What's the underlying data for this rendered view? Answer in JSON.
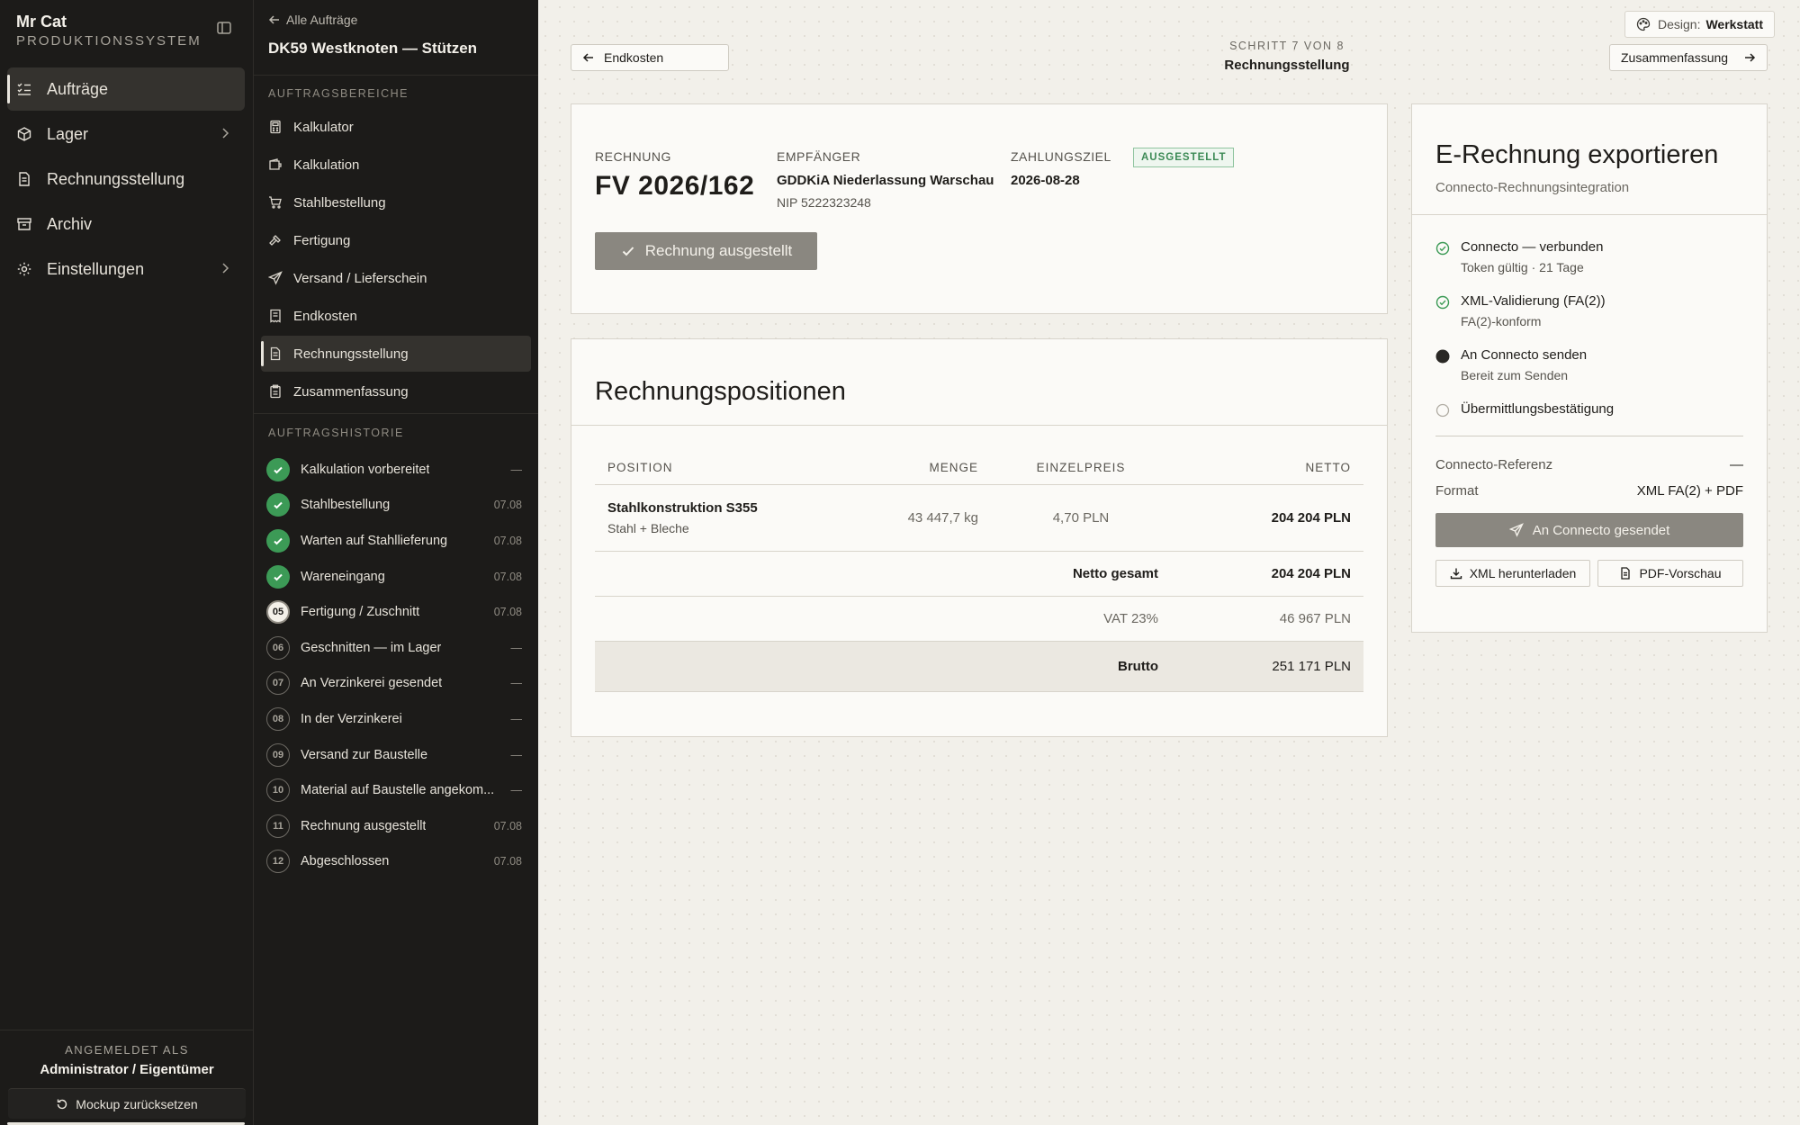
{
  "sidebar": {
    "brand_name": "Mr Cat",
    "brand_sub": "PRODUKTIONSSYSTEM",
    "nav": [
      {
        "label": "Aufträge",
        "icon": "list-check-icon",
        "active": true,
        "chevron": false
      },
      {
        "label": "Lager",
        "icon": "package-icon",
        "active": false,
        "chevron": true
      },
      {
        "label": "Rechnungsstellung",
        "icon": "document-icon",
        "active": false,
        "chevron": false
      },
      {
        "label": "Archiv",
        "icon": "archive-icon",
        "active": false,
        "chevron": false
      },
      {
        "label": "Einstellungen",
        "icon": "gear-icon",
        "active": false,
        "chevron": true
      }
    ],
    "footer_label": "ANGEMELDET ALS",
    "footer_user": "Administrator / Eigentümer",
    "reset_label": "Mockup zurücksetzen"
  },
  "panel": {
    "back_label": "Alle Aufträge",
    "job_title": "DK59 Westknoten — Stützen",
    "areas_heading": "AUFTRAGSBEREICHE",
    "areas": [
      {
        "label": "Kalkulator",
        "icon": "calculator-icon"
      },
      {
        "label": "Kalkulation",
        "icon": "wallet-icon"
      },
      {
        "label": "Stahlbestellung",
        "icon": "cart-icon"
      },
      {
        "label": "Fertigung",
        "icon": "hammer-icon"
      },
      {
        "label": "Versand / Lieferschein",
        "icon": "send-icon"
      },
      {
        "label": "Endkosten",
        "icon": "receipt-icon"
      },
      {
        "label": "Rechnungsstellung",
        "icon": "document-icon",
        "active": true
      },
      {
        "label": "Zusammenfassung",
        "icon": "clipboard-icon"
      }
    ],
    "history_heading": "AUFTRAGSHISTORIE",
    "history": [
      {
        "badge": "",
        "state": "done",
        "label": "Kalkulation vorbereitet",
        "date": "—"
      },
      {
        "badge": "",
        "state": "done",
        "label": "Stahlbestellung",
        "date": "07.08"
      },
      {
        "badge": "",
        "state": "done",
        "label": "Warten auf Stahllieferung",
        "date": "07.08"
      },
      {
        "badge": "",
        "state": "done",
        "label": "Wareneingang",
        "date": "07.08"
      },
      {
        "badge": "05",
        "state": "current",
        "label": "Fertigung / Zuschnitt",
        "date": "07.08"
      },
      {
        "badge": "06",
        "state": "pending",
        "label": "Geschnitten — im Lager",
        "date": "—"
      },
      {
        "badge": "07",
        "state": "pending",
        "label": "An Verzinkerei gesendet",
        "date": "—"
      },
      {
        "badge": "08",
        "state": "pending",
        "label": "In der Verzinkerei",
        "date": "—"
      },
      {
        "badge": "09",
        "state": "pending",
        "label": "Versand zur Baustelle",
        "date": "—"
      },
      {
        "badge": "10",
        "state": "pending",
        "label": "Material auf Baustelle angekom...",
        "date": "—"
      },
      {
        "badge": "11",
        "state": "pending",
        "label": "Rechnung ausgestellt",
        "date": "07.08"
      },
      {
        "badge": "12",
        "state": "pending",
        "label": "Abgeschlossen",
        "date": "07.08"
      }
    ]
  },
  "topbar": {
    "design_label": "Design:",
    "design_value": "Werkstatt",
    "prev_label": "Endkosten",
    "next_label": "Zusammenfassung",
    "step_small": "SCHRITT 7 VON 8",
    "step_title": "Rechnungsstellung"
  },
  "invoice": {
    "no_label": "RECHNUNG",
    "no_value": "FV 2026/162",
    "recipient_label": "EMPFÄNGER",
    "recipient_name": "GDDKiA Niederlassung Warschau",
    "recipient_nip": "NIP 5222323248",
    "due_label": "ZAHLUNGSZIEL",
    "due_value": "2026-08-28",
    "status": "AUSGESTELLT",
    "issued_button": "Rechnung ausgestellt"
  },
  "positions": {
    "title": "Rechnungspositionen",
    "headers": {
      "position": "POSITION",
      "menge": "MENGE",
      "einzelpreis": "EINZELPREIS",
      "netto": "NETTO"
    },
    "rows": [
      {
        "name": "Stahlkonstruktion S355",
        "sub": "Stahl + Bleche",
        "menge": "43 447,7 kg",
        "einzelpreis": "4,70 PLN",
        "netto": "204 204 PLN"
      }
    ],
    "netto_label": "Netto gesamt",
    "netto_value": "204 204 PLN",
    "vat_label": "VAT 23%",
    "vat_value": "46 967 PLN",
    "brutto_label": "Brutto",
    "brutto_value": "251 171 PLN"
  },
  "erechnung": {
    "title": "E-Rechnung exportieren",
    "subtitle": "Connecto-Rechnungsintegration",
    "checks": [
      {
        "title": "Connecto — verbunden",
        "sub": "Token gültig · 21 Tage",
        "state": "ok"
      },
      {
        "title": "XML-Validierung (FA(2))",
        "sub": "FA(2)-konform",
        "state": "ok"
      },
      {
        "title": "An Connecto senden",
        "sub": "Bereit zum Senden",
        "state": "active"
      },
      {
        "title": "Übermittlungsbestätigung",
        "sub": "",
        "state": "pending"
      }
    ],
    "ref_label": "Connecto-Referenz",
    "ref_value": "—",
    "format_label": "Format",
    "format_value": "XML FA(2) + PDF",
    "send_button": "An Connecto gesendet",
    "xml_button": "XML herunterladen",
    "pdf_button": "PDF-Vorschau"
  },
  "colors": {
    "success": "#3c9a56",
    "sidebar": "#1c1b19",
    "disabled_button": "#8a8780"
  }
}
